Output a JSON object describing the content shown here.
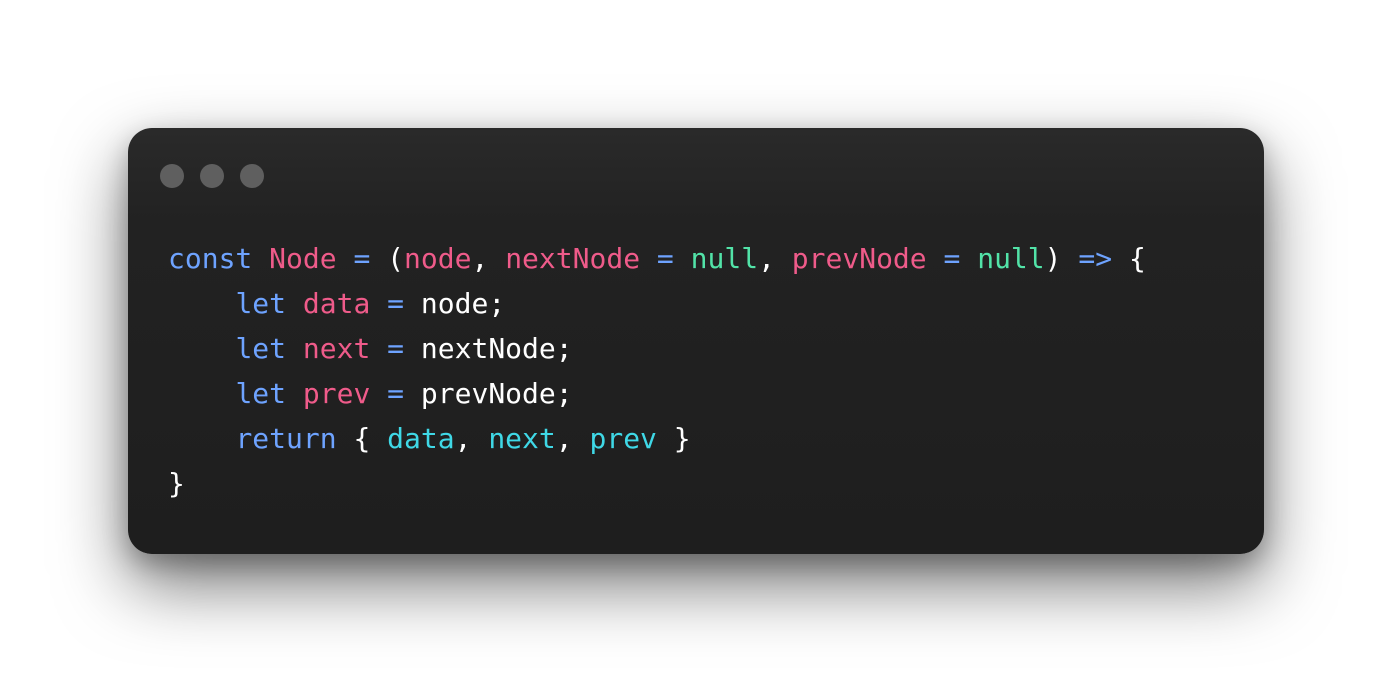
{
  "window_controls": [
    "close",
    "minimize",
    "maximize"
  ],
  "code_lines": [
    [
      {
        "t": "const",
        "k": "kw"
      },
      {
        "t": " ",
        "k": "pl"
      },
      {
        "t": "Node",
        "k": "id"
      },
      {
        "t": " ",
        "k": "pl"
      },
      {
        "t": "=",
        "k": "op"
      },
      {
        "t": " (",
        "k": "pl"
      },
      {
        "t": "node",
        "k": "id"
      },
      {
        "t": ", ",
        "k": "pl"
      },
      {
        "t": "nextNode",
        "k": "id"
      },
      {
        "t": " ",
        "k": "pl"
      },
      {
        "t": "=",
        "k": "op"
      },
      {
        "t": " ",
        "k": "pl"
      },
      {
        "t": "null",
        "k": "nl"
      },
      {
        "t": ", ",
        "k": "pl"
      },
      {
        "t": "prevNode",
        "k": "id"
      },
      {
        "t": " ",
        "k": "pl"
      },
      {
        "t": "=",
        "k": "op"
      },
      {
        "t": " ",
        "k": "pl"
      },
      {
        "t": "null",
        "k": "nl"
      },
      {
        "t": ") ",
        "k": "pl"
      },
      {
        "t": "=>",
        "k": "op"
      },
      {
        "t": " {",
        "k": "pl"
      }
    ],
    [
      {
        "t": "    ",
        "k": "pl"
      },
      {
        "t": "let",
        "k": "kw"
      },
      {
        "t": " ",
        "k": "pl"
      },
      {
        "t": "data",
        "k": "id"
      },
      {
        "t": " ",
        "k": "pl"
      },
      {
        "t": "=",
        "k": "op"
      },
      {
        "t": " node;",
        "k": "pl"
      }
    ],
    [
      {
        "t": "    ",
        "k": "pl"
      },
      {
        "t": "let",
        "k": "kw"
      },
      {
        "t": " ",
        "k": "pl"
      },
      {
        "t": "next",
        "k": "id"
      },
      {
        "t": " ",
        "k": "pl"
      },
      {
        "t": "=",
        "k": "op"
      },
      {
        "t": " nextNode;",
        "k": "pl"
      }
    ],
    [
      {
        "t": "    ",
        "k": "pl"
      },
      {
        "t": "let",
        "k": "kw"
      },
      {
        "t": " ",
        "k": "pl"
      },
      {
        "t": "prev",
        "k": "id"
      },
      {
        "t": " ",
        "k": "pl"
      },
      {
        "t": "=",
        "k": "op"
      },
      {
        "t": " prevNode;",
        "k": "pl"
      }
    ],
    [
      {
        "t": "    ",
        "k": "pl"
      },
      {
        "t": "return",
        "k": "kw"
      },
      {
        "t": " { ",
        "k": "pl"
      },
      {
        "t": "data",
        "k": "pr"
      },
      {
        "t": ", ",
        "k": "pl"
      },
      {
        "t": "next",
        "k": "pr"
      },
      {
        "t": ", ",
        "k": "pl"
      },
      {
        "t": "prev",
        "k": "pr"
      },
      {
        "t": " }",
        "k": "pl"
      }
    ],
    [
      {
        "t": "}",
        "k": "pl"
      }
    ]
  ],
  "colors": {
    "keyword": "#6ea3ff",
    "operator": "#6ea3ff",
    "identifier": "#ef5b8a",
    "null_literal": "#52e3a8",
    "property": "#3fd8e6",
    "plain": "#ffffff",
    "background": "#1e1e1e",
    "dot": "#5f5f5f"
  }
}
